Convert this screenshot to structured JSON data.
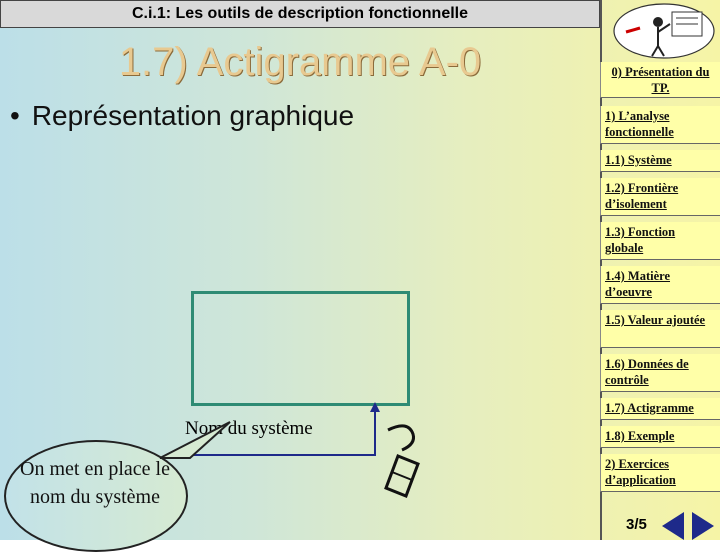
{
  "header": {
    "text": "C.i.1: Les outils de description fonctionnelle"
  },
  "title": "1.7) Actigramme A-0",
  "bullet": {
    "symbol": "•",
    "text": "Représentation graphique"
  },
  "diagram": {
    "system_label": "Nom du système",
    "bubble_text": "On met en place le nom du système"
  },
  "nav": {
    "items": [
      "0) Présentation du TP.",
      "1) L’analyse fonctionnelle",
      "1.1) Système",
      "1.2) Frontière d’isolement",
      "1.3) Fonction globale",
      "1.4) Matière d’oeuvre",
      "1.5) Valeur ajoutée",
      "1.6) Données de contrôle",
      "1.7) Actigramme",
      "1.8) Exemple",
      "2) Exercices d’application"
    ]
  },
  "pager": {
    "label": "3/5"
  },
  "colors": {
    "accent_box": "#2e8b74",
    "nav_bg": "#ffffa8",
    "nav_arrows": "#1e2a8a",
    "title": "#e8c990"
  }
}
